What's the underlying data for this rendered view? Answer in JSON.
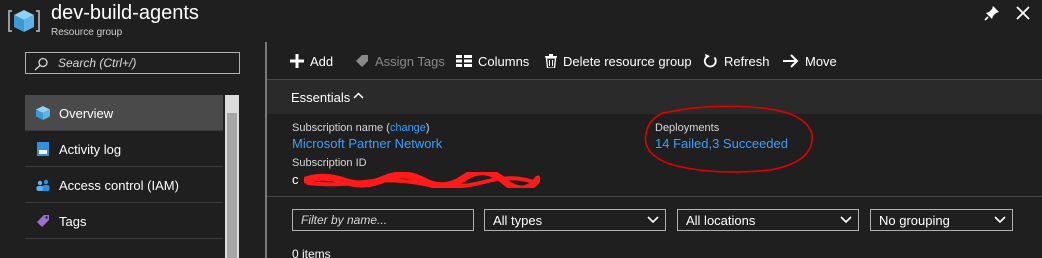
{
  "header": {
    "title": "dev-build-agents",
    "subtitle": "Resource group",
    "icon": "resource-group-cube-icon"
  },
  "search": {
    "placeholder": "Search (Ctrl+/)"
  },
  "sidebar": {
    "items": [
      {
        "label": "Overview",
        "icon": "cube-icon",
        "active": true
      },
      {
        "label": "Activity log",
        "icon": "log-icon",
        "active": false
      },
      {
        "label": "Access control (IAM)",
        "icon": "people-icon",
        "active": false
      },
      {
        "label": "Tags",
        "icon": "tag-icon",
        "active": false
      }
    ]
  },
  "toolbar": {
    "add": "Add",
    "assign_tags": "Assign Tags",
    "columns": "Columns",
    "delete": "Delete resource group",
    "refresh": "Refresh",
    "move": "Move"
  },
  "essentials": {
    "header": "Essentials",
    "subscription_name_label": "Subscription name (",
    "change_link": "change",
    "subscription_name_label_end": ")",
    "subscription_name": "Microsoft Partner Network",
    "subscription_id_label": "Subscription ID",
    "subscription_id_prefix": "c",
    "deployments_label": "Deployments",
    "deployments_value": "14 Failed,3 Succeeded"
  },
  "filters": {
    "name_placeholder": "Filter by name...",
    "types": "All types",
    "locations": "All locations",
    "grouping": "No grouping"
  },
  "list": {
    "count": "0 items"
  },
  "colors": {
    "background": "#1f1f1f",
    "link": "#3aa0ff",
    "annotation": "#e00000",
    "icon_blue": "#5bb3e8"
  }
}
